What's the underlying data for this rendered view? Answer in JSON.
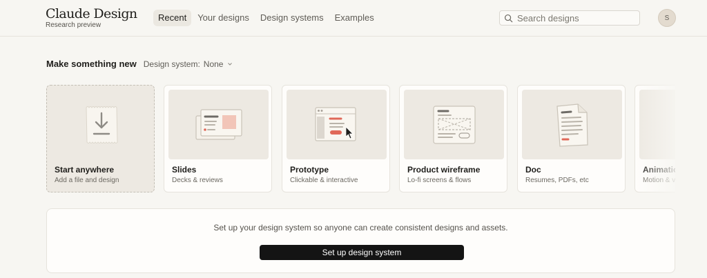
{
  "brand": {
    "title": "Claude Design",
    "subtitle": "Research preview"
  },
  "nav": [
    {
      "label": "Recent",
      "active": true
    },
    {
      "label": "Your designs"
    },
    {
      "label": "Design systems"
    },
    {
      "label": "Examples"
    }
  ],
  "search": {
    "placeholder": "Search designs",
    "icon": "search-icon"
  },
  "user": {
    "initial": "S"
  },
  "make_section": {
    "title": "Make something new",
    "design_system_label": "Design system:",
    "design_system_value": "None"
  },
  "cards": [
    {
      "title": "Start anywhere",
      "subtitle": "Add a file and design",
      "icon": "download-icon"
    },
    {
      "title": "Slides",
      "subtitle": "Decks & reviews",
      "icon": "slides-icon"
    },
    {
      "title": "Prototype",
      "subtitle": "Clickable & interactive",
      "icon": "prototype-icon"
    },
    {
      "title": "Product wireframe",
      "subtitle": "Lo-fi screens & flows",
      "icon": "wireframe-icon"
    },
    {
      "title": "Doc",
      "subtitle": "Resumes, PDFs, etc",
      "icon": "doc-icon"
    },
    {
      "title": "Animation",
      "subtitle": "Motion & video",
      "icon": "animation-icon"
    }
  ],
  "setup": {
    "message": "Set up your design system so anyone can create consistent designs and assets.",
    "button_label": "Set up design system"
  },
  "colors": {
    "background": "#f7f6f2",
    "accent_red": "#e06858",
    "button": "#141414"
  }
}
